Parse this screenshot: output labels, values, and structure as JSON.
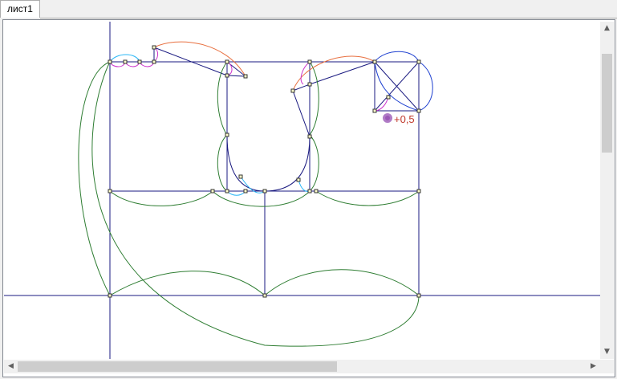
{
  "tabs": [
    {
      "label": "лист1"
    }
  ],
  "annotation": {
    "value_label": "+0,5",
    "color": "#c0392b",
    "marker_color": "#9b59b6"
  },
  "colors": {
    "construction_line": "#1a1a80",
    "arc_green": "#2e7d32",
    "arc_orange": "#e87040",
    "arc_magenta": "#cc33cc",
    "arc_cyan": "#29b6f6",
    "circle_blue": "#1e40d0"
  },
  "icons": {
    "scroll_up": "▲",
    "scroll_down": "▼",
    "scroll_left": "◀",
    "scroll_right": "▶"
  }
}
